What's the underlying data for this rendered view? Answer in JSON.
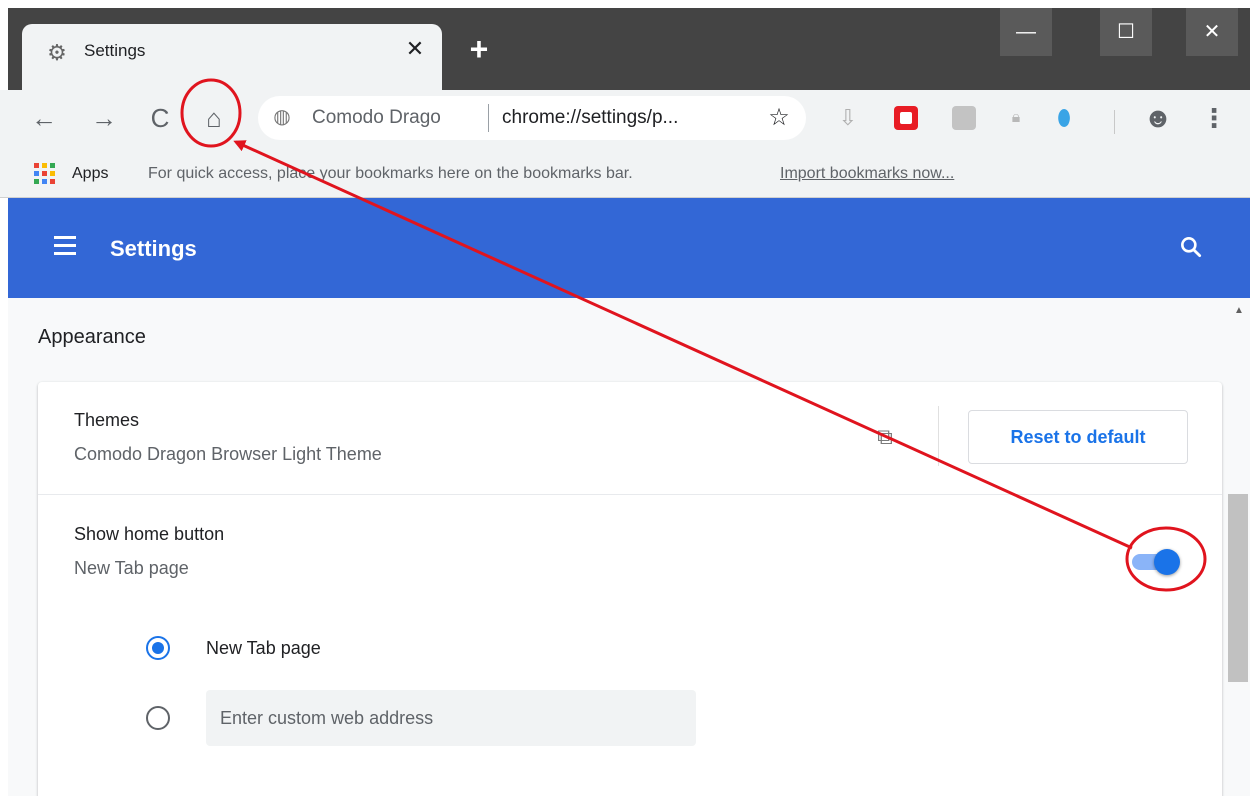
{
  "tab": {
    "title": "Settings",
    "icon": "gear-icon",
    "close_label": "✕"
  },
  "new_tab_label": "+",
  "window_controls": {
    "minimize": "—",
    "maximize": "☐",
    "close": "✕"
  },
  "toolbar": {
    "back": "←",
    "forward": "→",
    "reload": "C",
    "home": "⌂",
    "site_name": "Comodo Drago",
    "url": "chrome://settings/p...",
    "star": "☆",
    "account": "☻",
    "menu": "⋮"
  },
  "bookmarks": {
    "apps_label": "Apps",
    "message": "For quick access, place your bookmarks here on the bookmarks bar.",
    "import_link": "Import bookmarks now..."
  },
  "header": {
    "title": "Settings",
    "search_icon": "search-icon"
  },
  "appearance": {
    "section_title": "Appearance",
    "themes": {
      "title": "Themes",
      "value": "Comodo Dragon Browser Light Theme",
      "reset_label": "Reset to default"
    },
    "home_button": {
      "title": "Show home button",
      "value": "New Tab page",
      "toggle_on": true,
      "options": [
        {
          "label": "New Tab page",
          "checked": true
        },
        {
          "label": "",
          "checked": false
        }
      ],
      "custom_placeholder": "Enter custom web address"
    }
  },
  "colors": {
    "header_blue": "#3367d6",
    "accent": "#1a73e8",
    "annotation_red": "#e0141e"
  }
}
